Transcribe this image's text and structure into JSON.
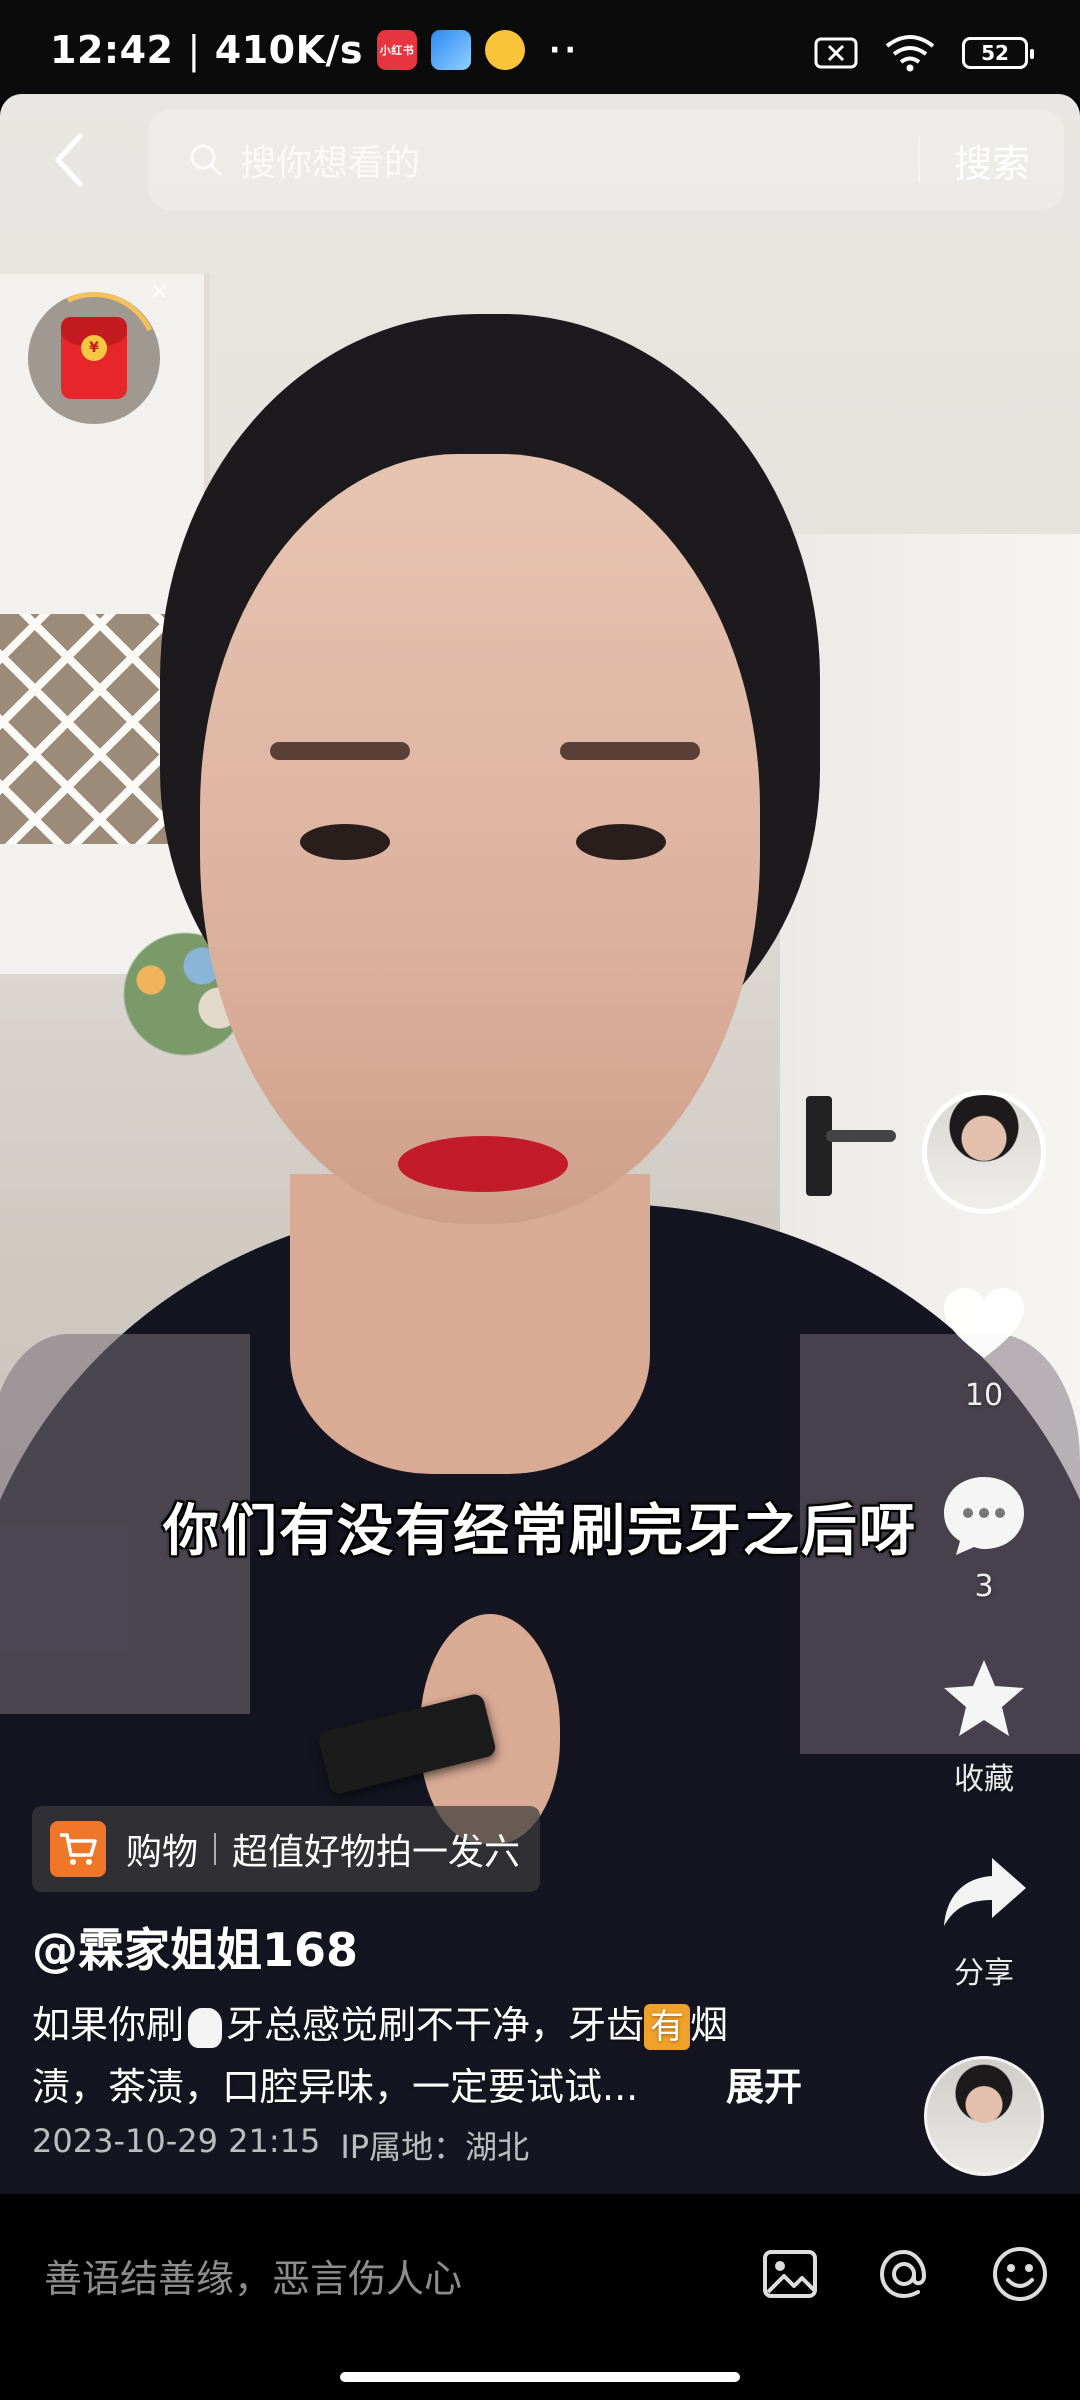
{
  "status_bar": {
    "time": "12:42",
    "speed": "410K/s",
    "app_badge_1": "小红书",
    "dots": "··",
    "battery": "52"
  },
  "search": {
    "placeholder": "搜你想看的",
    "button_label": "搜索"
  },
  "video": {
    "subtitle": "你们有没有经常刷完牙之后呀"
  },
  "right_rail": {
    "like_count": "10",
    "comment_count": "3",
    "favorite_label": "收藏",
    "share_label": "分享"
  },
  "shop_tag": {
    "label": "购物",
    "desc": "超值好物拍一发六"
  },
  "post": {
    "author": "@霖家姐姐168",
    "caption_part1": "如果你刷",
    "caption_part2": "牙总感觉刷不干净，牙齿",
    "caption_highlight": "有",
    "caption_part3": "烟",
    "caption_line2": "渍，茶渍，口腔异味，一定要试试...",
    "expand_label": "展开",
    "date": "2023-10-29 21:15",
    "ip_location": "IP属地：湖北"
  },
  "comment_bar": {
    "placeholder": "善语结善缘，恶言伤人心"
  },
  "icons": {
    "back": "chevron-left-icon",
    "search": "search-icon",
    "like": "heart-icon",
    "comment": "comment-bubble-icon",
    "favorite": "star-icon",
    "share": "share-arrow-icon",
    "image": "image-icon",
    "mention": "at-icon",
    "emoji": "emoji-icon"
  },
  "colors": {
    "shop_accent": "#f0762a",
    "redpacket": "#e6262b",
    "lips": "#c21b2b"
  }
}
